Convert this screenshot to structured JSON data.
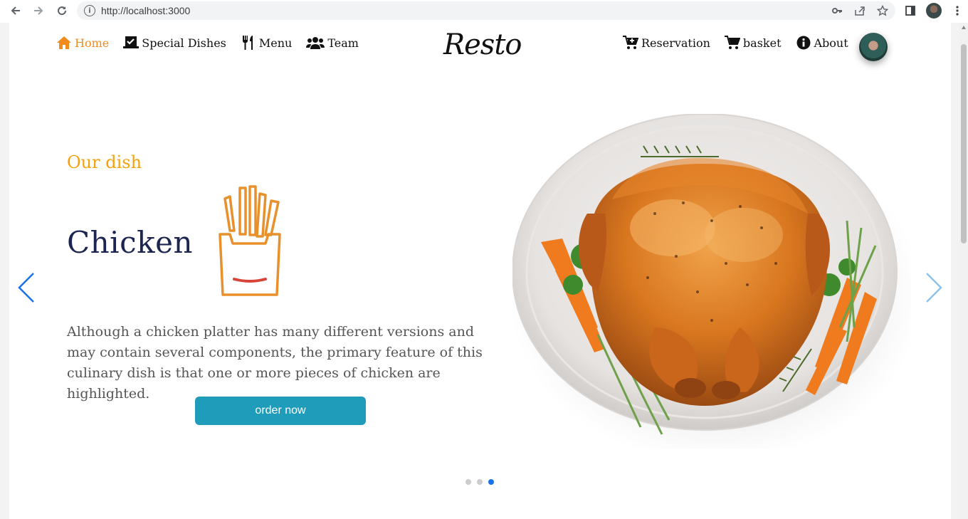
{
  "browser": {
    "url": "http://localhost:3000"
  },
  "nav_left": [
    {
      "label": "Home",
      "icon": "home-icon",
      "active": true
    },
    {
      "label": "Special Dishes",
      "icon": "laptop-check-icon"
    },
    {
      "label": "Menu",
      "icon": "utensils-icon"
    },
    {
      "label": "Team",
      "icon": "users-icon"
    }
  ],
  "brand": "Resto",
  "nav_right": [
    {
      "label": "Reservation",
      "icon": "cart-plus-icon"
    },
    {
      "label": "basket",
      "icon": "cart-icon"
    },
    {
      "label": "About",
      "icon": "info-circle-icon"
    }
  ],
  "hero": {
    "eyebrow": "Our dish",
    "title": "Chicken",
    "description": "Although a chicken platter has many different versions and may contain several components, the primary feature of this culinary dish is that one or more pieces of chicken are highlighted.",
    "button_label": "order now"
  },
  "carousel": {
    "slide_count": 3,
    "active_slide": 3
  },
  "colors": {
    "accent_orange": "#f28b1e",
    "eyebrow_yellow": "#f3a20c",
    "title_navy": "#1b2550",
    "button_teal": "#1f9cb9",
    "active_dot": "#1a73e8"
  }
}
